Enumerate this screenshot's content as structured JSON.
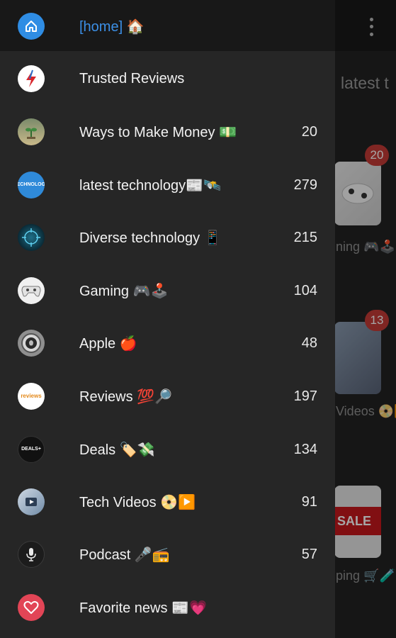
{
  "background": {
    "heading": "latest t",
    "badges": [
      "20",
      "13"
    ],
    "labels": [
      "ning 🎮🕹️",
      "Videos 📀▶️",
      "ping 🛒🧪"
    ],
    "sale_text": "SALE"
  },
  "drawer": {
    "items": [
      {
        "label": "[home] 🏠",
        "count": "",
        "icon": "home-icon"
      },
      {
        "label": "Trusted Reviews",
        "count": "",
        "icon": "lightning-icon"
      },
      {
        "label": "Ways to Make Money 💵",
        "count": "20",
        "icon": "plant-icon"
      },
      {
        "label": "latest technology📰🛰️",
        "count": "279",
        "icon": "tech-icon"
      },
      {
        "label": "Diverse technology 📱",
        "count": "215",
        "icon": "circuit-icon"
      },
      {
        "label": "Gaming 🎮🕹️",
        "count": "104",
        "icon": "gamepad-icon"
      },
      {
        "label": "Apple 🍎",
        "count": "48",
        "icon": "apple-icon"
      },
      {
        "label": "Reviews 💯🔎",
        "count": "197",
        "icon": "reviews-icon"
      },
      {
        "label": "Deals 🏷️💸",
        "count": "134",
        "icon": "deals-icon"
      },
      {
        "label": "Tech Videos 📀▶️",
        "count": "91",
        "icon": "video-icon"
      },
      {
        "label": "Podcast 🎤📻",
        "count": "57",
        "icon": "microphone-icon"
      },
      {
        "label": "Favorite news 📰💗",
        "count": "",
        "icon": "heart-icon"
      }
    ]
  },
  "avatars": {
    "tech_text": "TECHNOLOGY",
    "reviews_text": "reviews",
    "deals_text": "DEALS+"
  },
  "colors": {
    "accent": "#3c8fe6",
    "drawer_bg": "#262626",
    "badge": "#c53b36",
    "favorite": "#e24556"
  }
}
